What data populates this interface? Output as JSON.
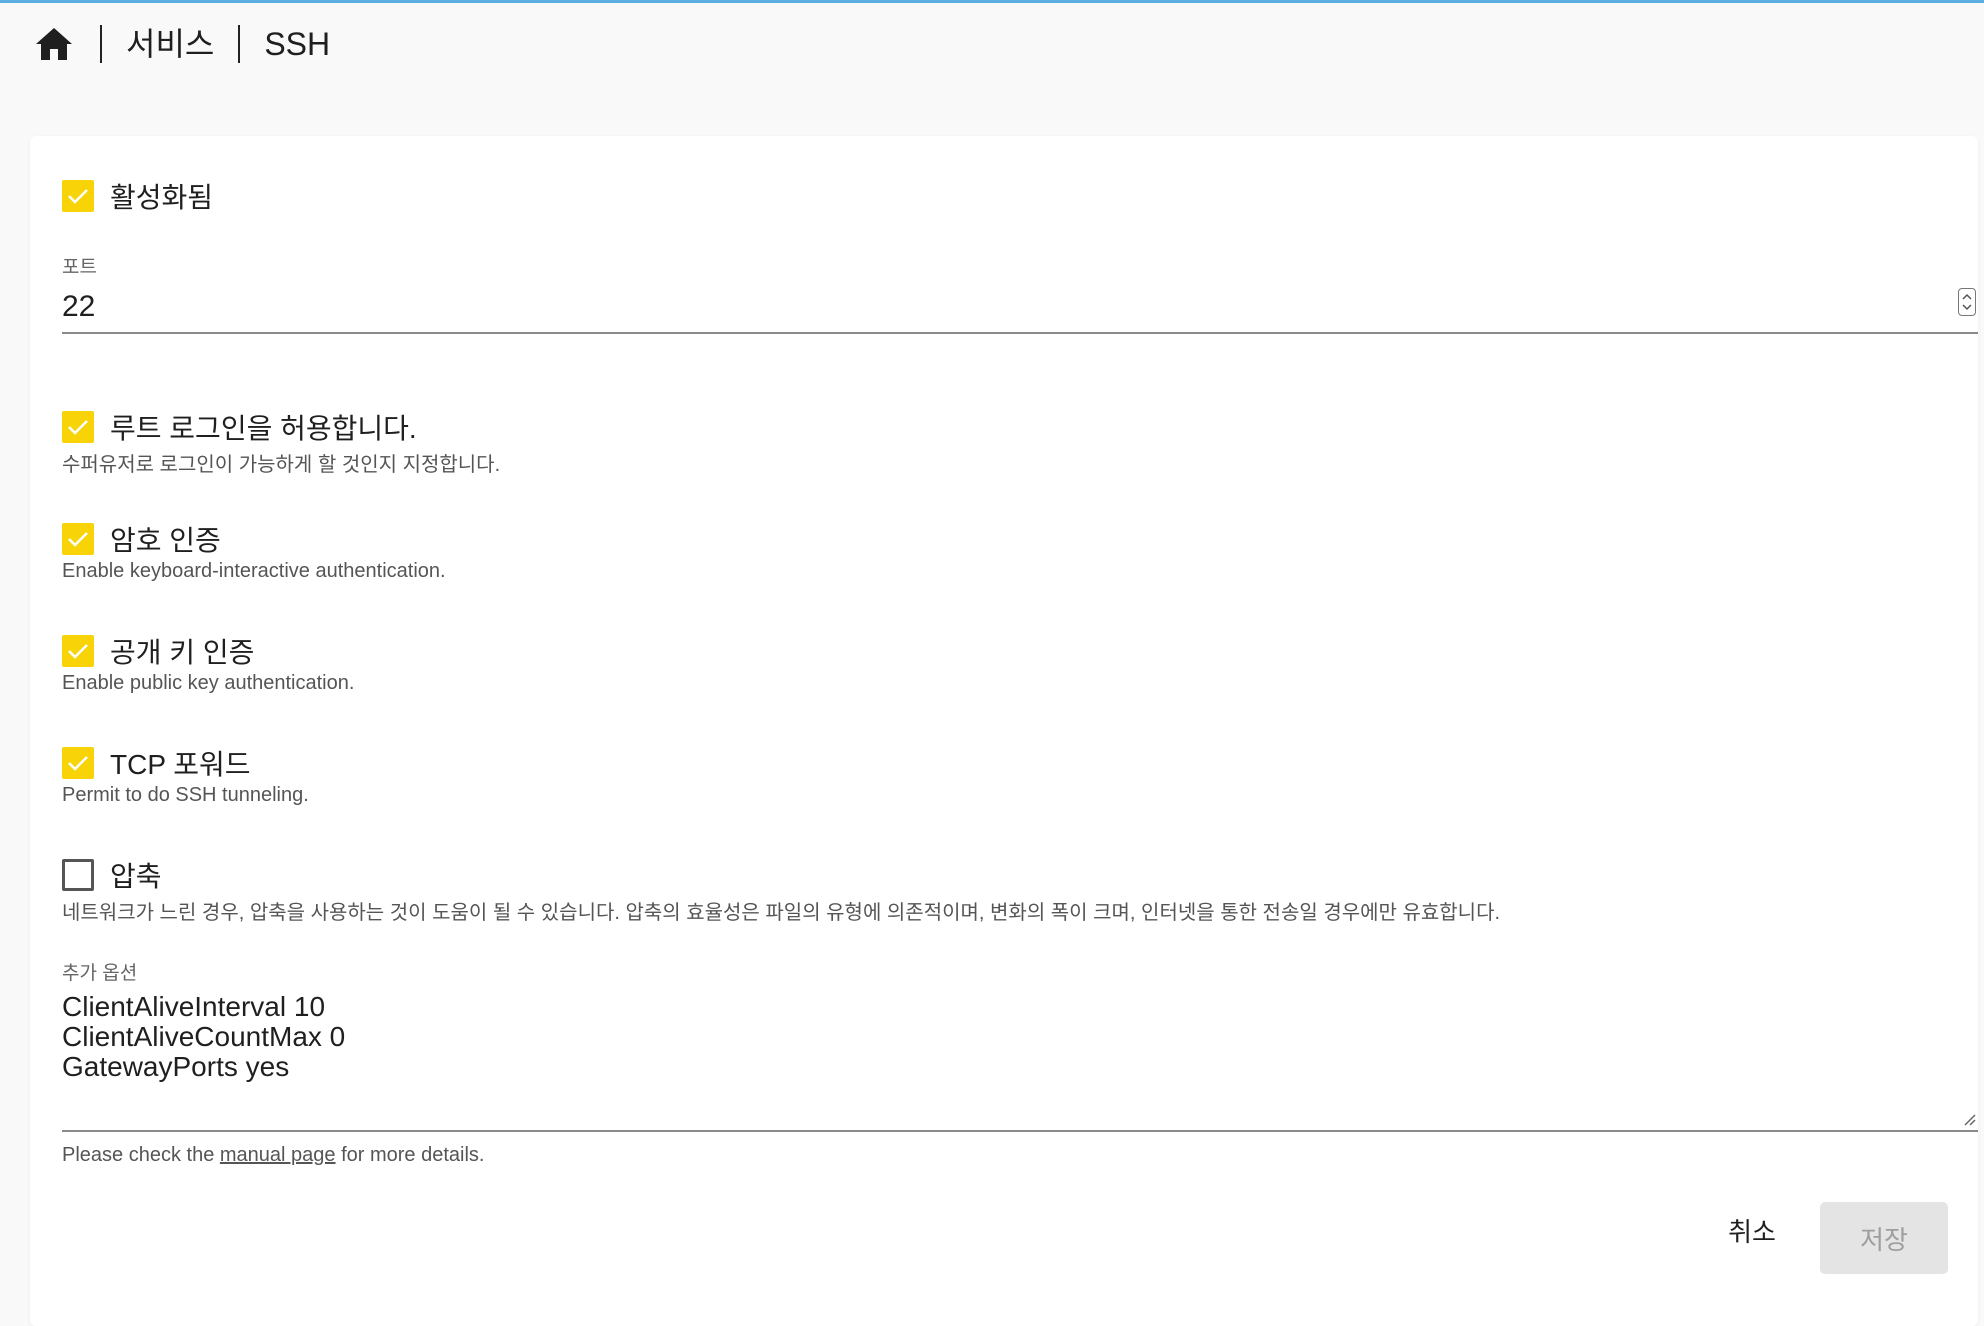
{
  "breadcrumb": {
    "items": [
      {
        "label": "서비스"
      },
      {
        "label": "SSH"
      }
    ]
  },
  "form": {
    "enabled": {
      "label": "활성화됨",
      "checked": true
    },
    "port": {
      "label": "포트",
      "value": "22"
    },
    "root_login": {
      "label": "루트 로그인을 허용합니다.",
      "hint": "수퍼유저로 로그인이 가능하게 할 것인지 지정합니다.",
      "checked": true
    },
    "password_auth": {
      "label": "암호 인증",
      "hint": "Enable keyboard-interactive authentication.",
      "checked": true
    },
    "pubkey_auth": {
      "label": "공개 키 인증",
      "hint": "Enable public key authentication.",
      "checked": true
    },
    "tcp_forwarding": {
      "label": "TCP 포워드",
      "hint": "Permit to do SSH tunneling.",
      "checked": true
    },
    "compression": {
      "label": "압축",
      "hint": "네트워크가 느린 경우, 압축을 사용하는 것이 도움이 될 수 있습니다. 압축의 효율성은 파일의 유형에 의존적이며, 변화의 폭이 크며, 인터넷을 통한 전송일 경우에만 유효합니다.",
      "checked": false
    },
    "extra_options": {
      "label": "추가 옵션",
      "lines": [
        "ClientAliveInterval 10",
        "ClientAliveCountMax 0",
        "GatewayPorts yes"
      ],
      "helper_prefix": "Please check the ",
      "helper_link": "manual page",
      "helper_suffix": " for more details."
    }
  },
  "actions": {
    "cancel_label": "취소",
    "save_label": "저장"
  },
  "colors": {
    "accent": "#f8d308",
    "top_bar": "#5aaee0",
    "disabled_button": "#e4e4e4"
  }
}
